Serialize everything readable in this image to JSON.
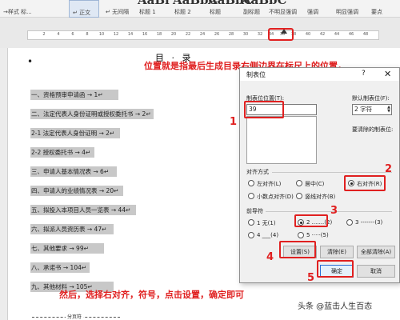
{
  "ribbon": {
    "styles": [
      {
        "preview": "",
        "label": "→样式 标..."
      },
      {
        "preview": "",
        "label": "↵ 正文"
      },
      {
        "preview": "",
        "label": "↵ 无间隔"
      },
      {
        "preview": "AaBl",
        "label": "标题 1"
      },
      {
        "preview": "AaBbC",
        "label": "标题 2"
      },
      {
        "preview": "AaBbC",
        "label": "标题"
      },
      {
        "preview": "AaBbC",
        "label": "副标题"
      },
      {
        "preview": "",
        "label": "不明显强调"
      },
      {
        "preview": "",
        "label": "强调"
      },
      {
        "preview": "",
        "label": "明显强调"
      },
      {
        "preview": "",
        "label": "要点"
      }
    ]
  },
  "ruler": {
    "numbers": [
      "2",
      "4",
      "6",
      "8",
      "10",
      "12",
      "14",
      "16",
      "18",
      "20",
      "22",
      "24",
      "26",
      "28",
      "30",
      "32",
      "34",
      "36",
      "38",
      "40",
      "42",
      "44",
      "46",
      "48"
    ]
  },
  "document": {
    "title": "目 · 录",
    "toc": [
      "一、资格预审申请函 → 1↵",
      "二、法定代表人身份证明或授权委托书 → 2↵",
      "2-1 法定代表人身份证明 → 2↵",
      "2-2 授权委托书 → 4↵",
      "三、申请人基本情况表 →  6↵",
      "四、申请人的业绩情况表 → 20↵",
      "五、拟投入本项目人员一览表 → 44↵",
      "六、拟派人员资历表 → 47↵",
      "七、其他要求 →  99↵",
      "八、承诺书 → 104↵",
      "九、其他材料 →  105↵"
    ],
    "page_break": "分页符"
  },
  "dialog": {
    "title": "制表位",
    "help": "?",
    "close": "✕",
    "tab_position_label": "制表位位置(T):",
    "tab_position_value": "39",
    "default_tab_label": "默认制表位(F):",
    "default_tab_value": "2 字符",
    "clear_label": "要清除的制表位:",
    "alignment_label": "对齐方式",
    "alignment": [
      {
        "label": "左对齐(L)",
        "checked": false
      },
      {
        "label": "居中(C)",
        "checked": false
      },
      {
        "label": "右对齐(R)",
        "checked": true
      },
      {
        "label": "小数点对齐(D)",
        "checked": false
      },
      {
        "label": "竖线对齐(B)",
        "checked": false
      }
    ],
    "leader_label": "前导符",
    "leaders": [
      {
        "label": "1 无(1)",
        "checked": false
      },
      {
        "label": "2 .......(2)",
        "checked": true
      },
      {
        "label": "3 -------(3)",
        "checked": false
      },
      {
        "label": "4 ___(4)",
        "checked": false
      },
      {
        "label": "5 ·····(5)",
        "checked": false
      }
    ],
    "buttons": {
      "set": "设置(S)",
      "clear": "清除(E)",
      "clear_all": "全部清除(A)",
      "ok": "确定",
      "cancel": "取消"
    }
  },
  "annotations": {
    "top_note": "位置就是指最后生成目录右侧边界在标尺上的位置，",
    "bottom_note": "然后，选择右对齐，符号，点击设置，确定即可",
    "step_numbers": [
      "1",
      "2",
      "3",
      "4",
      "5"
    ]
  },
  "watermark": "头条 @蓝击人生百态",
  "colors": {
    "annotation_red": "#e02020",
    "selection_gray": "#c8c8c8",
    "dialog_bg": "#f0f0f0"
  }
}
